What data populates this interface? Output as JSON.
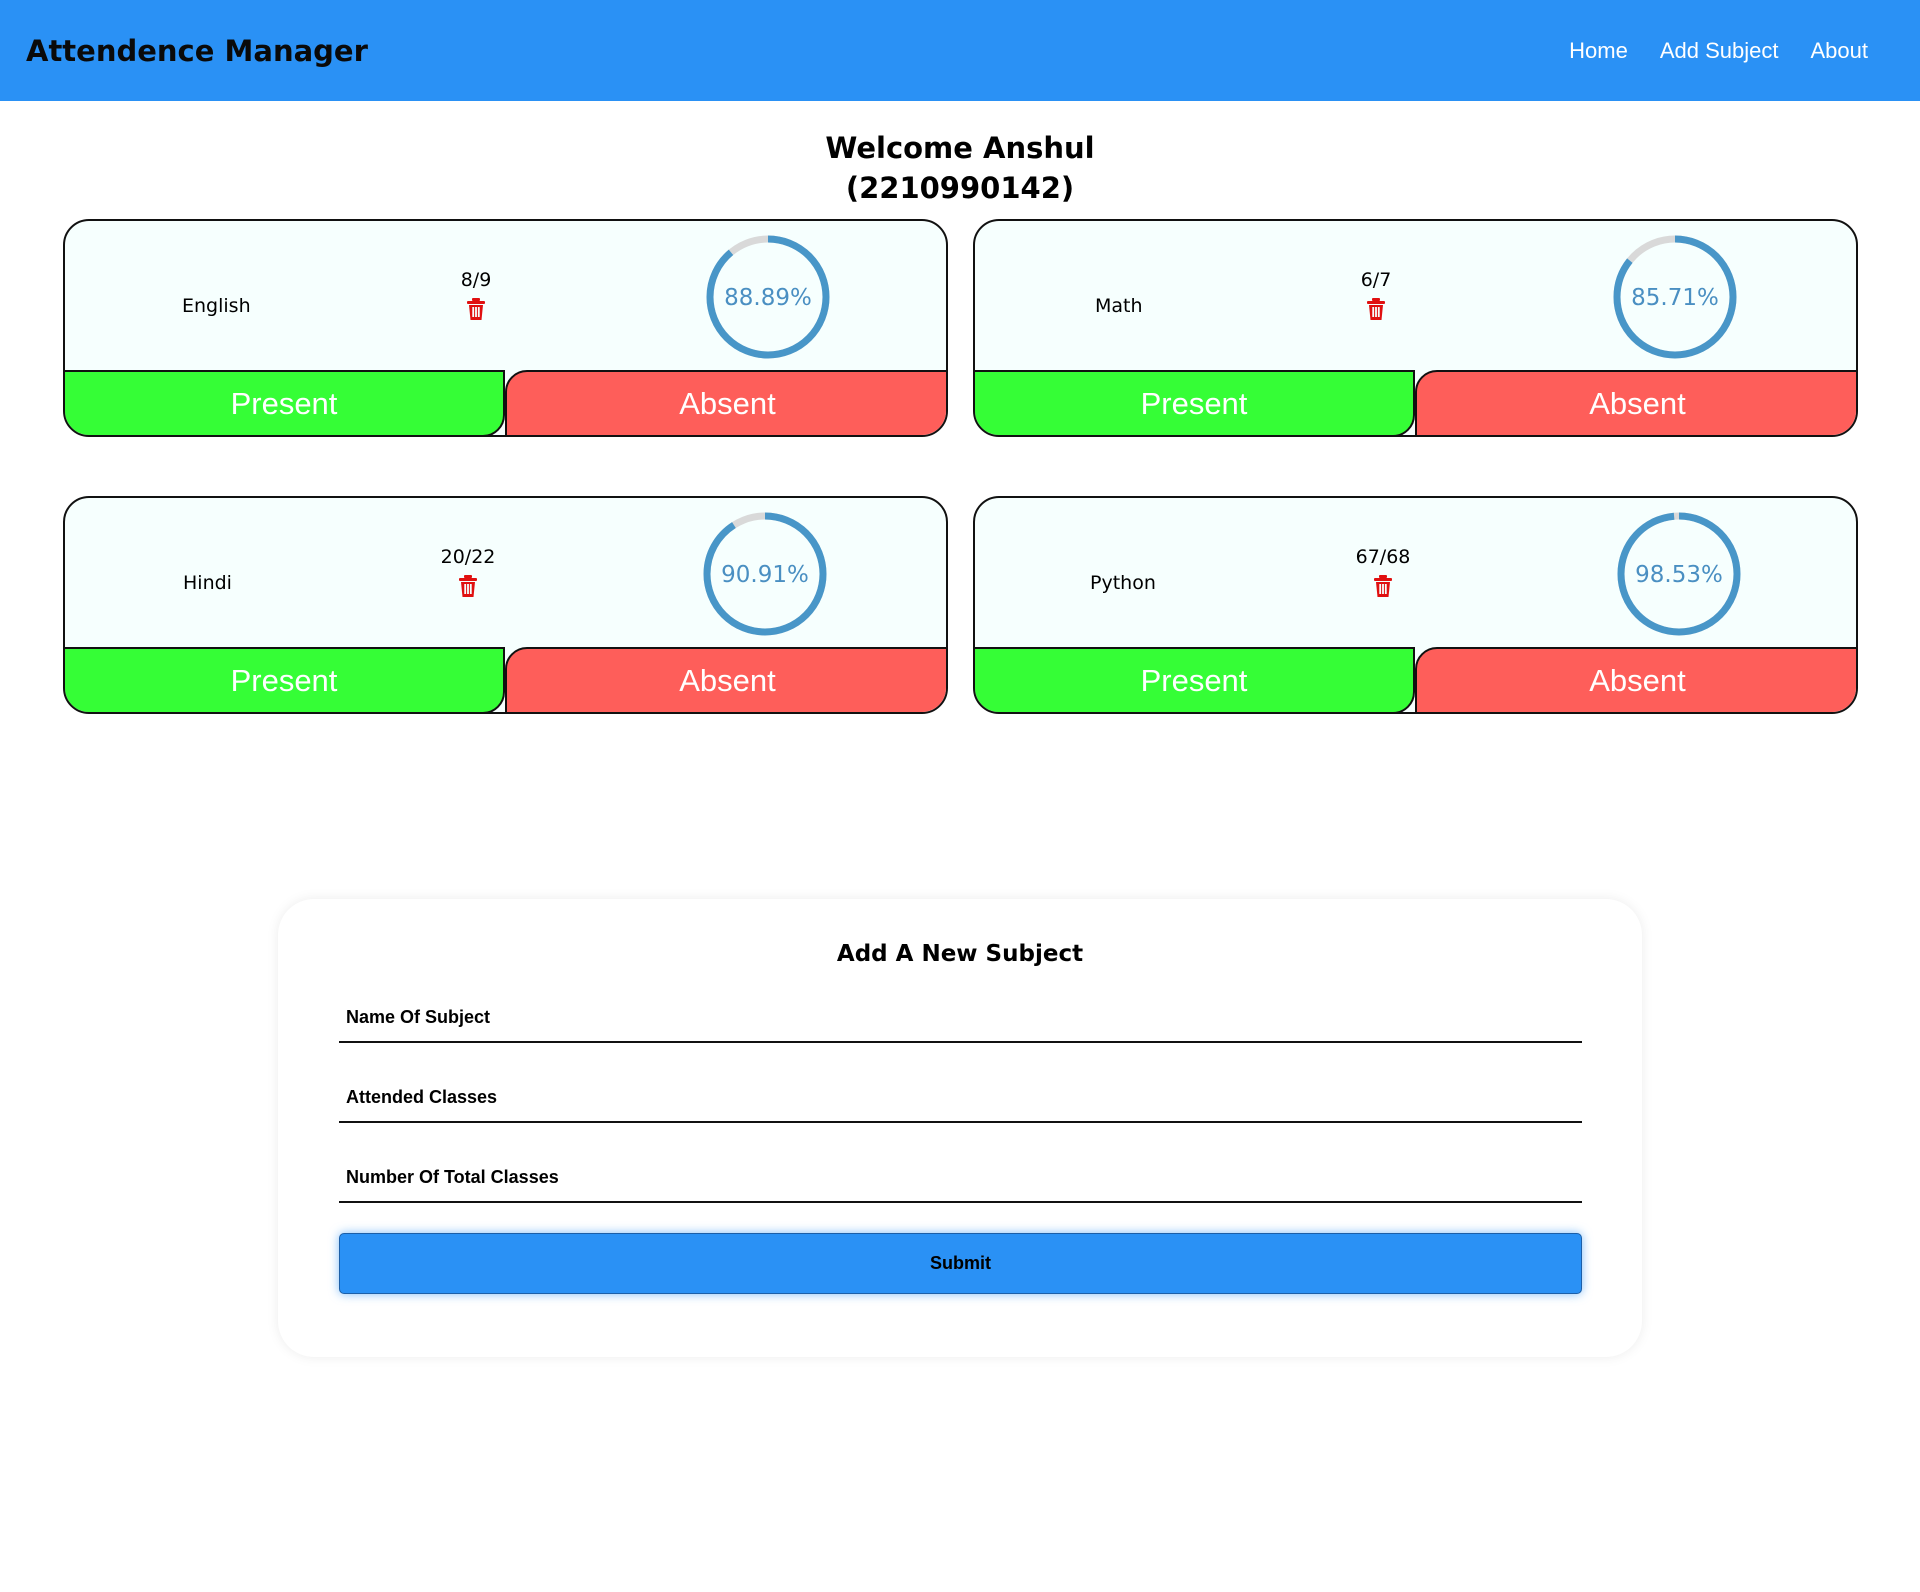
{
  "navbar": {
    "brand": "Attendence Manager",
    "links": [
      "Home",
      "Add Subject",
      "About"
    ]
  },
  "welcome": {
    "line1": "Welcome Anshul",
    "line2": "(2210990142)"
  },
  "subjects": [
    {
      "name": "English",
      "ratio": "8/9",
      "attended": 8,
      "total": 9,
      "percent_label": "88.89%",
      "percent": 88.89,
      "present_label": "Present",
      "absent_label": "Absent"
    },
    {
      "name": "Math",
      "ratio": "6/7",
      "attended": 6,
      "total": 7,
      "percent_label": "85.71%",
      "percent": 85.71,
      "present_label": "Present",
      "absent_label": "Absent"
    },
    {
      "name": "Hindi",
      "ratio": "20/22",
      "attended": 20,
      "total": 22,
      "percent_label": "90.91%",
      "percent": 90.91,
      "present_label": "Present",
      "absent_label": "Absent"
    },
    {
      "name": "Python",
      "ratio": "67/68",
      "attended": 67,
      "total": 68,
      "percent_label": "98.53%",
      "percent": 98.53,
      "present_label": "Present",
      "absent_label": "Absent"
    }
  ],
  "form": {
    "title": "Add A New Subject",
    "name_placeholder": "Name Of Subject",
    "attended_placeholder": "Attended Classes",
    "total_placeholder": "Number Of Total Classes",
    "submit_label": "Submit"
  },
  "colors": {
    "navbar": "#2a91f5",
    "present": "#35fe36",
    "absent": "#fe5e5a",
    "ring": "#4896c8",
    "ring_track": "#d9d9d9",
    "trash": "#e01010"
  },
  "icons": {
    "delete": "trash-icon"
  }
}
